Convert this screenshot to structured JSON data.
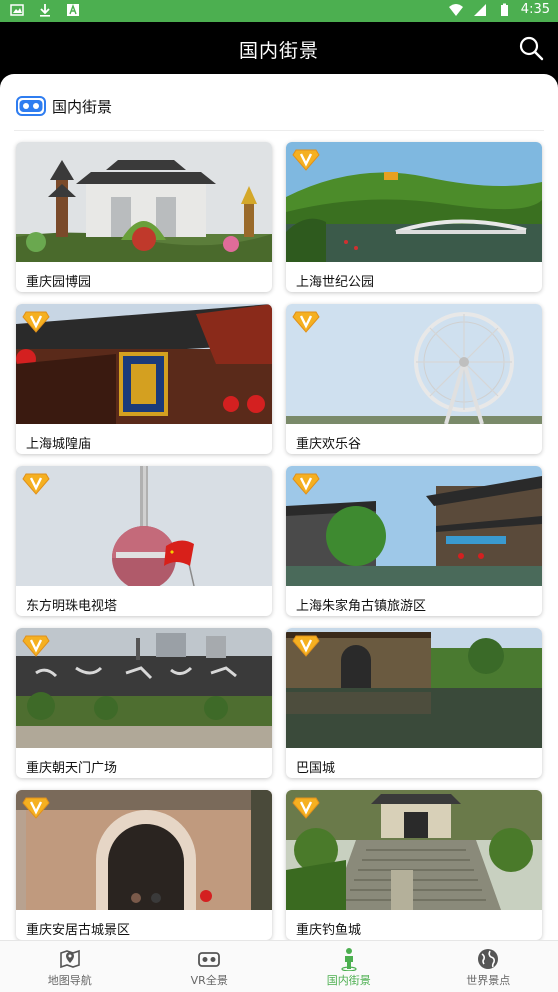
{
  "status_bar": {
    "time": "4:35",
    "color": "#4caf50"
  },
  "app_bar": {
    "title": "国内街景"
  },
  "section": {
    "title": "国内街景"
  },
  "cards": [
    {
      "label": "重庆园博园",
      "vip": false
    },
    {
      "label": "上海世纪公园",
      "vip": true
    },
    {
      "label": "上海城隍庙",
      "vip": true
    },
    {
      "label": "重庆欢乐谷",
      "vip": true
    },
    {
      "label": "东方明珠电视塔",
      "vip": true
    },
    {
      "label": "上海朱家角古镇旅游区",
      "vip": true
    },
    {
      "label": "重庆朝天门广场",
      "vip": true
    },
    {
      "label": "巴国城",
      "vip": true
    },
    {
      "label": "重庆安居古城景区",
      "vip": true
    },
    {
      "label": "重庆钓鱼城",
      "vip": true
    }
  ],
  "nav": {
    "items": [
      {
        "label": "地图导航",
        "icon": "map-pin-icon"
      },
      {
        "label": "VR全景",
        "icon": "vr-headset-icon"
      },
      {
        "label": "国内街景",
        "icon": "person-icon"
      },
      {
        "label": "世界景点",
        "icon": "globe-icon"
      }
    ],
    "active_index": 2,
    "active_color": "#4caf50"
  }
}
